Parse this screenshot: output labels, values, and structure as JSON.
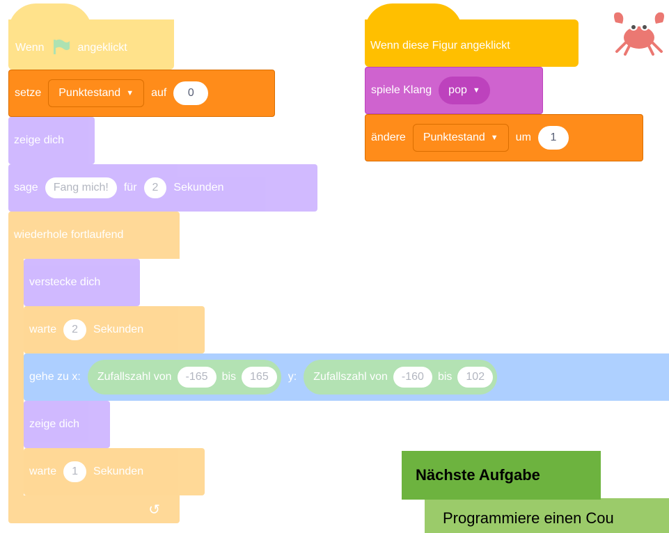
{
  "script1": {
    "hat": {
      "text1": "Wenn",
      "text2": "angeklickt",
      "icon": "green-flag-icon"
    },
    "set_var": {
      "label": "setze",
      "variable": "Punktestand",
      "to_label": "auf",
      "value": "0"
    },
    "show1": {
      "label": "zeige dich"
    },
    "say": {
      "label": "sage",
      "message": "Fang mich!",
      "for_label": "für",
      "seconds": "2",
      "unit": "Sekunden"
    },
    "forever": {
      "label": "wiederhole fortlaufend",
      "arrow": "↺"
    },
    "hide": {
      "label": "verstecke dich"
    },
    "wait1": {
      "label": "warte",
      "seconds": "2",
      "unit": "Sekunden"
    },
    "goto": {
      "label": "gehe zu x:",
      "rand_x": {
        "label": "Zufallszahl von",
        "from": "-165",
        "to_label": "bis",
        "to": "165"
      },
      "y_label": "y:",
      "rand_y": {
        "label": "Zufallszahl von",
        "from": "-160",
        "to_label": "bis",
        "to": "102"
      }
    },
    "show2": {
      "label": "zeige dich"
    },
    "wait2": {
      "label": "warte",
      "seconds": "1",
      "unit": "Sekunden"
    }
  },
  "script2": {
    "hat": {
      "label": "Wenn diese Figur angeklickt"
    },
    "play_sound": {
      "label": "spiele Klang",
      "sound": "pop"
    },
    "change_var": {
      "label": "ändere",
      "variable": "Punktestand",
      "by_label": "um",
      "value": "1"
    }
  },
  "sprite": {
    "icon": "crab-sprite-icon"
  },
  "next_task": {
    "title": "Nächste Aufgabe",
    "text": "Programmiere einen Cou"
  }
}
